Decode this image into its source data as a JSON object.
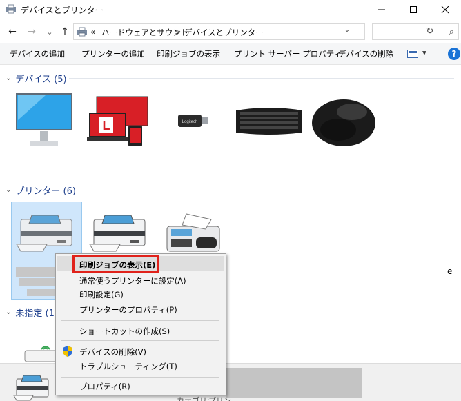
{
  "window": {
    "title": "デバイスとプリンター",
    "minimize": "—",
    "maximize": "☐",
    "close": "✕"
  },
  "nav": {
    "back": "←",
    "forward": "→",
    "recent": "⌄",
    "up": "↑",
    "breadcrumb_prefix": "«",
    "breadcrumb": [
      "ハードウェアとサウンド",
      "デバイスとプリンター"
    ],
    "breadcrumb_sep": ">",
    "search_placeholder": ""
  },
  "toolbar": {
    "items": [
      "デバイスの追加",
      "プリンターの追加",
      "印刷ジョブの表示",
      "プリント サーバー プロパティ",
      "デバイスの削除"
    ],
    "view_menu": "▾",
    "help": "?"
  },
  "groups": {
    "devices": {
      "label": "デバイス (5)",
      "chevron": "⌄"
    },
    "printers": {
      "label": "プリンター (6)",
      "chevron": "⌄"
    },
    "unspecified": {
      "label": "未指定 (1",
      "chevron": "⌄"
    }
  },
  "devices": [
    {
      "icon": "monitor-icon"
    },
    {
      "icon": "laptop-and-devices-icon",
      "badge": "L"
    },
    {
      "icon": "usb-receiver-icon",
      "brand": "Logitech"
    },
    {
      "icon": "keyboard-icon"
    },
    {
      "icon": "mouse-icon"
    }
  ],
  "printers": [
    {
      "icon": "printer-icon",
      "selected": true
    },
    {
      "icon": "printer-icon"
    },
    {
      "icon": "fax-icon"
    }
  ],
  "context_menu": {
    "items": [
      {
        "label": "印刷ジョブの表示(E)",
        "bold": true,
        "highlighted": true
      },
      {
        "label": "通常使うプリンターに設定(A)"
      },
      {
        "label": "印刷設定(G)"
      },
      {
        "label": "プリンターのプロパティ(P)"
      },
      {
        "label": "ショートカットの作成(S)"
      },
      {
        "label": "デバイスの削除(V)",
        "shield": true
      },
      {
        "label": "トラブルシューティング(T)"
      },
      {
        "label": "プロパティ(R)"
      }
    ]
  },
  "details": {
    "category_label": "カテゴリ:",
    "category_value": "プリン"
  },
  "colors": {
    "accent": "#1a73d6",
    "group_header": "#1e3f8c",
    "selection_bg": "#cfe6fb",
    "highlight_box": "#e0221b"
  }
}
